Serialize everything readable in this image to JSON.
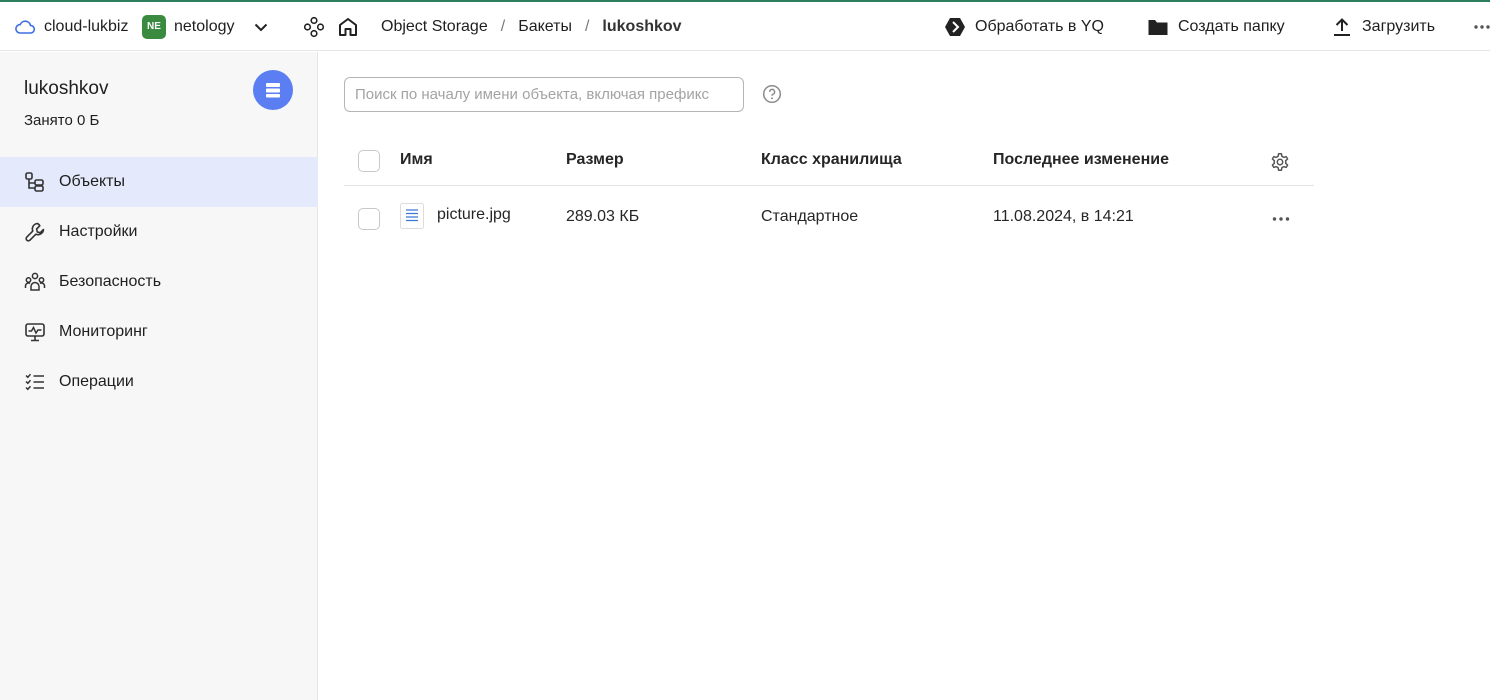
{
  "header": {
    "cloud": "cloud-lukbiz",
    "folder_badge": "NE",
    "folder": "netology",
    "breadcrumbs": [
      "Object Storage",
      "Бакеты",
      "lukoshkov"
    ],
    "separator": "/",
    "actions": {
      "yq": "Обработать в YQ",
      "create_folder": "Создать папку",
      "upload": "Загрузить"
    }
  },
  "sidebar": {
    "bucket_name": "lukoshkov",
    "bucket_used": "Занято 0 Б",
    "items": [
      {
        "label": "Объекты",
        "icon": "objects-icon",
        "active": true
      },
      {
        "label": "Настройки",
        "icon": "wrench-icon",
        "active": false
      },
      {
        "label": "Безопасность",
        "icon": "people-icon",
        "active": false
      },
      {
        "label": "Мониторинг",
        "icon": "monitor-icon",
        "active": false
      },
      {
        "label": "Операции",
        "icon": "list-check-icon",
        "active": false
      }
    ]
  },
  "search": {
    "placeholder": "Поиск по началу имени объекта, включая префикс",
    "value": ""
  },
  "table": {
    "columns": [
      "Имя",
      "Размер",
      "Класс хранилища",
      "Последнее изменение"
    ],
    "rows": [
      {
        "name": "picture.jpg",
        "size": "289.03 КБ",
        "storage_class": "Стандартное",
        "modified": "11.08.2024, в 14:21"
      }
    ]
  },
  "colors": {
    "accent": "#5b7ff2",
    "active_nav": "#e4e9fb",
    "folder_badge": "#3a8a3f"
  }
}
